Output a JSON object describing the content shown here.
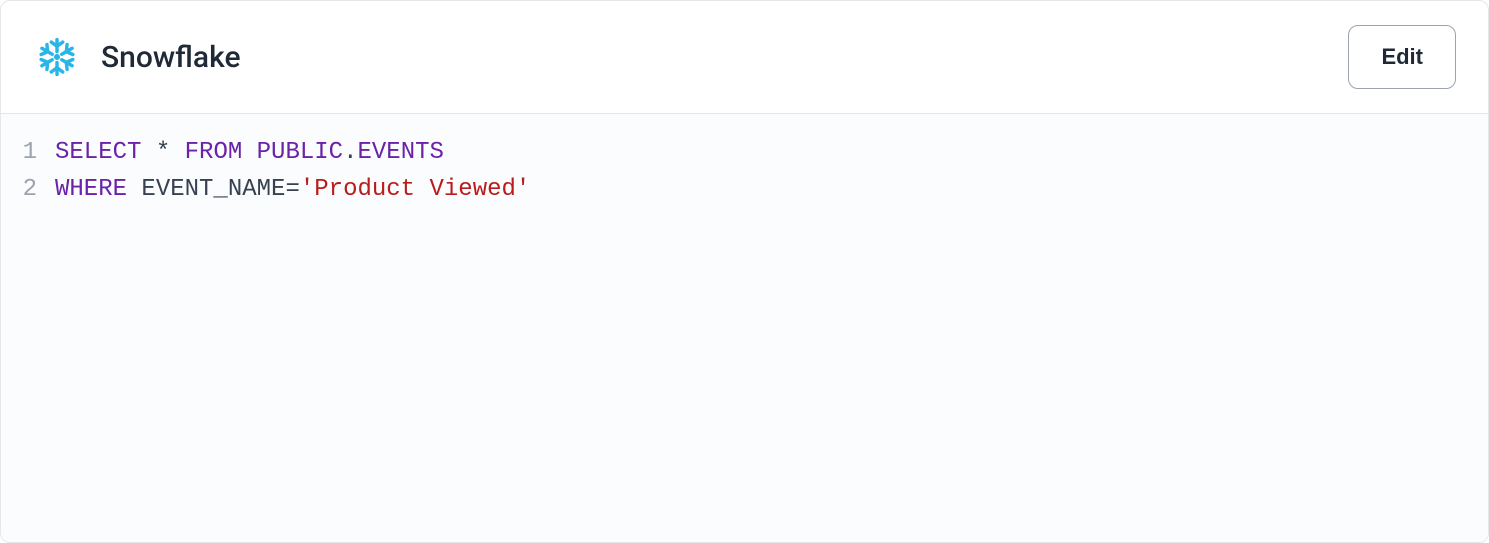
{
  "header": {
    "title": "Snowflake",
    "icon_name": "snowflake-icon",
    "edit_label": "Edit"
  },
  "code": {
    "lines": [
      {
        "no": "1",
        "tokens": [
          {
            "cls": "tok-kw",
            "t": "SELECT"
          },
          {
            "cls": "tok-plain",
            "t": " "
          },
          {
            "cls": "tok-op",
            "t": "*"
          },
          {
            "cls": "tok-plain",
            "t": " "
          },
          {
            "cls": "tok-kw",
            "t": "FROM"
          },
          {
            "cls": "tok-plain",
            "t": " "
          },
          {
            "cls": "tok-ident",
            "t": "PUBLIC"
          },
          {
            "cls": "tok-op",
            "t": "."
          },
          {
            "cls": "tok-ident",
            "t": "EVENTS"
          }
        ]
      },
      {
        "no": "2",
        "tokens": [
          {
            "cls": "tok-kw",
            "t": "WHERE"
          },
          {
            "cls": "tok-plain",
            "t": " "
          },
          {
            "cls": "tok-plain",
            "t": "EVENT_NAME"
          },
          {
            "cls": "tok-eq",
            "t": "="
          },
          {
            "cls": "tok-str",
            "t": "'Product Viewed'"
          }
        ]
      }
    ]
  }
}
